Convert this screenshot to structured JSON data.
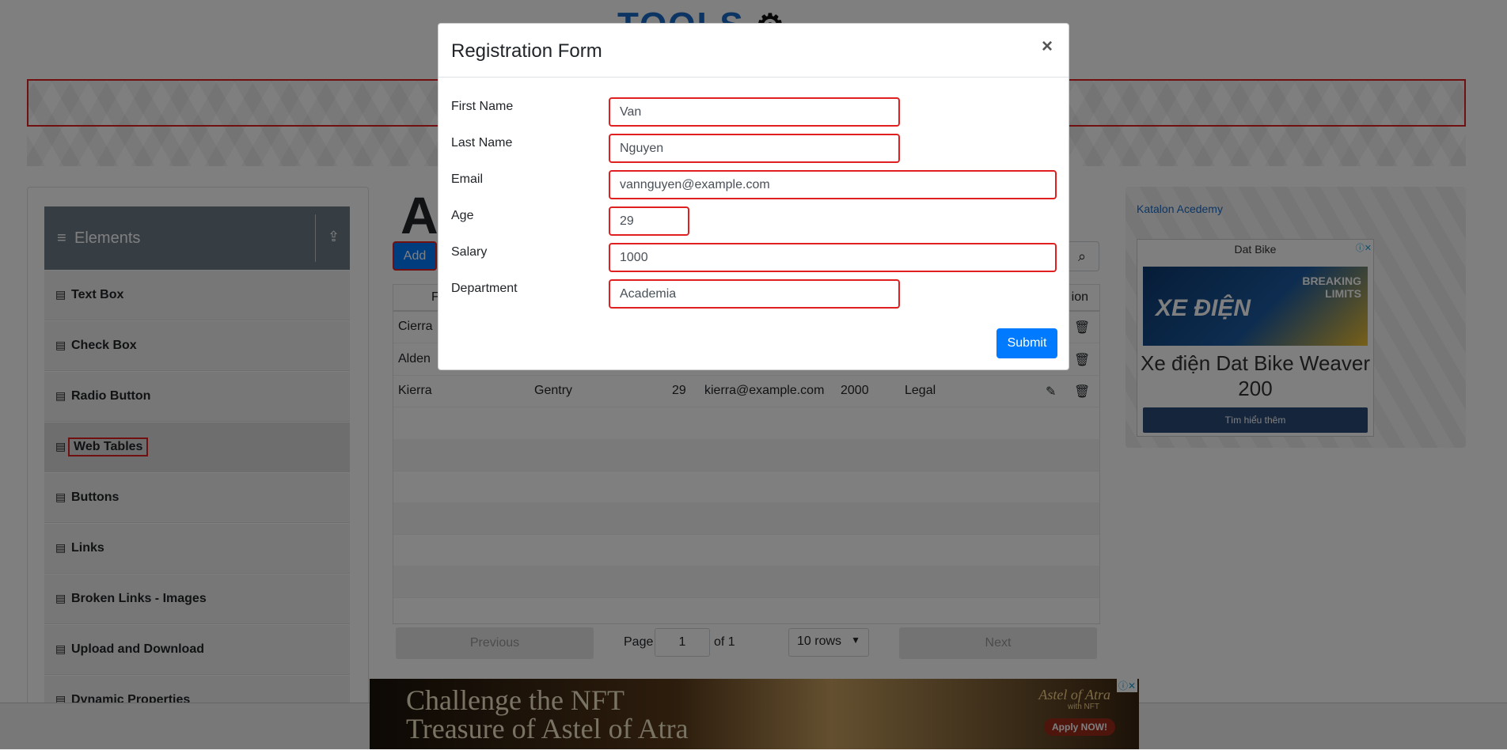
{
  "header": {
    "logo_text": "TOOLS",
    "logo_icon": "gear-icon"
  },
  "sidebar": {
    "group_title": "Elements",
    "items": [
      {
        "label": "Text Box"
      },
      {
        "label": "Check Box"
      },
      {
        "label": "Radio Button"
      },
      {
        "label": "Web Tables",
        "active": true
      },
      {
        "label": "Buttons"
      },
      {
        "label": "Links"
      },
      {
        "label": "Broken Links - Images"
      },
      {
        "label": "Upload and Download"
      },
      {
        "label": "Dynamic Properties"
      }
    ]
  },
  "main": {
    "heading_fragment": "A",
    "add_label": "Add",
    "table": {
      "header_first_fragment": "F",
      "header_action_fragment": "ion",
      "rows": [
        {
          "first": "Cierra",
          "last": "",
          "age": "",
          "email": "",
          "salary": "",
          "department": ""
        },
        {
          "first": "Alden",
          "last": "",
          "age": "",
          "email": "",
          "salary": "",
          "department": ""
        },
        {
          "first": "Kierra",
          "last": "Gentry",
          "age": "29",
          "email": "kierra@example.com",
          "salary": "2000",
          "department": "Legal"
        }
      ]
    },
    "pagination": {
      "previous": "Previous",
      "page_label": "Page",
      "page_value": "1",
      "of_label": "of 1",
      "rows_option": "10 rows",
      "next": "Next"
    }
  },
  "ads": {
    "right_link": "Katalon Acedemy",
    "dat_bike": {
      "brand": "Dat Bike",
      "image_text": "XE ĐIỆN",
      "image_tag": "BREAKING LIMITS",
      "headline": "Xe điện Dat Bike Weaver 200",
      "cta": "Tìm hiểu thêm"
    },
    "bottom": {
      "line1": "Challenge the NFT",
      "line2": "Treasure of Astel of Atra",
      "game_logo": "Astel of Atra",
      "game_sub": "with NFT",
      "apply": "Apply NOW!"
    }
  },
  "modal": {
    "title": "Registration Form",
    "close_glyph": "×",
    "fields": {
      "first_name": {
        "label": "First Name",
        "value": "Van"
      },
      "last_name": {
        "label": "Last Name",
        "value": "Nguyen"
      },
      "email": {
        "label": "Email",
        "value": "vannguyen@example.com"
      },
      "age": {
        "label": "Age",
        "value": "29"
      },
      "salary": {
        "label": "Salary",
        "value": "1000"
      },
      "department": {
        "label": "Department",
        "value": "Academia"
      }
    },
    "submit_label": "Submit"
  },
  "colors": {
    "accent": "#007bff",
    "error_border": "#e02020",
    "overlay": "rgba(0,0,0,0.5)"
  }
}
